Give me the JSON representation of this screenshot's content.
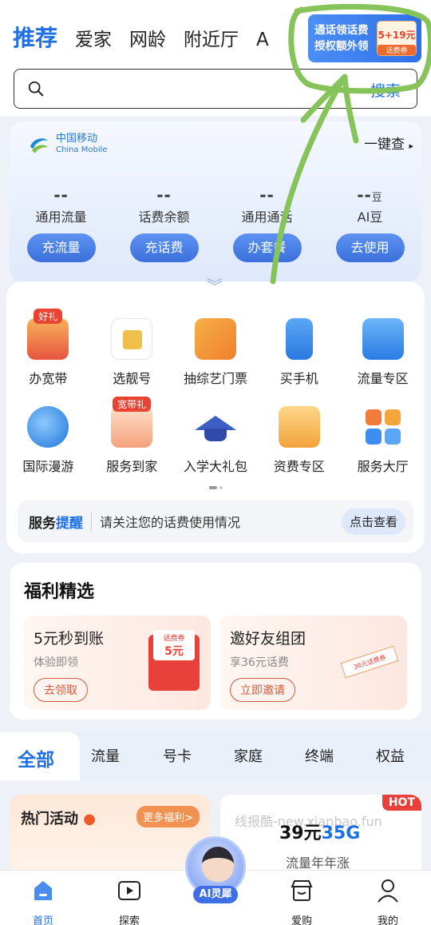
{
  "header": {
    "tabs": [
      "推荐",
      "爱家",
      "网龄",
      "附近厅",
      "A"
    ],
    "promo": {
      "line1": "通话领话费",
      "line2": "授权额外领",
      "amount": "5+19元",
      "tag": "话费券"
    }
  },
  "search": {
    "placeholder": "",
    "button": "搜索"
  },
  "account": {
    "brand": "中国移动",
    "brand_en": "China Mobile",
    "one_key": "一键查",
    "stats": [
      {
        "value": "--",
        "label": "通用流量",
        "button": "充流量"
      },
      {
        "value": "--",
        "label": "话费余额",
        "button": "充话费"
      },
      {
        "value": "--",
        "label": "通用通话",
        "button": "办套餐"
      },
      {
        "value": "--",
        "unit": "豆",
        "label": "AI豆",
        "button": "去使用"
      }
    ]
  },
  "services": {
    "items": [
      {
        "label": "办宽带",
        "badge": "好礼",
        "icon": "broadband-gift-icon",
        "color": "#e8533f"
      },
      {
        "label": "选靓号",
        "icon": "sim-card-icon",
        "color": "#f0b63d"
      },
      {
        "label": "抽综艺门票",
        "icon": "ticket-icon",
        "color": "#f29a3a"
      },
      {
        "label": "买手机",
        "icon": "phone-icon",
        "color": "#3d8ef0"
      },
      {
        "label": "流量专区",
        "icon": "data-store-icon",
        "color": "#3a86e8"
      },
      {
        "label": "国际漫游",
        "icon": "airplane-icon",
        "color": "#2f84e6"
      },
      {
        "label": "服务到家",
        "badge": "宽带礼",
        "icon": "home-service-icon",
        "color": "#e8533f"
      },
      {
        "label": "入学大礼包",
        "icon": "graduation-cap-icon",
        "color": "#3c5fc4"
      },
      {
        "label": "资费专区",
        "icon": "tariff-folder-icon",
        "color": "#f2a33a"
      },
      {
        "label": "服务大厅",
        "icon": "service-hall-icon",
        "color": "#f07a3a"
      }
    ],
    "reminder": {
      "title_a": "服务",
      "title_b": "提醒",
      "message": "请关注您的话费使用情况",
      "action": "点击查看"
    }
  },
  "welfare": {
    "title": "福利精选",
    "cards": [
      {
        "title": "5元秒到账",
        "sub": "体验即领",
        "action": "去领取",
        "coupon_tag": "话费券",
        "coupon_amt": "5元"
      },
      {
        "title": "邀好友组团",
        "sub": "享36元话费",
        "action": "立即邀请",
        "coupon_amt": "36元话费券"
      }
    ]
  },
  "categories": [
    "全部",
    "流量",
    "号卡",
    "家庭",
    "终端",
    "权益"
  ],
  "activities": {
    "hot_title": "热门活动",
    "hot_more": "更多福利>",
    "watermark": "线报酷-new.xianbao.fun",
    "hot_tag": "HOT",
    "price_a": "39元",
    "price_b": "35G",
    "plan_desc": "流量年年涨"
  },
  "bottom_nav": [
    {
      "label": "首页",
      "icon": "home-icon"
    },
    {
      "label": "探索",
      "icon": "play-icon"
    },
    {
      "label": "AI灵犀",
      "icon": "ai-avatar-icon"
    },
    {
      "label": "爱购",
      "icon": "shop-icon"
    },
    {
      "label": "我的",
      "icon": "user-icon"
    }
  ],
  "colors": {
    "accent": "#1f6fe5",
    "annotation": "#86c35a",
    "hot": "#e9403b"
  }
}
